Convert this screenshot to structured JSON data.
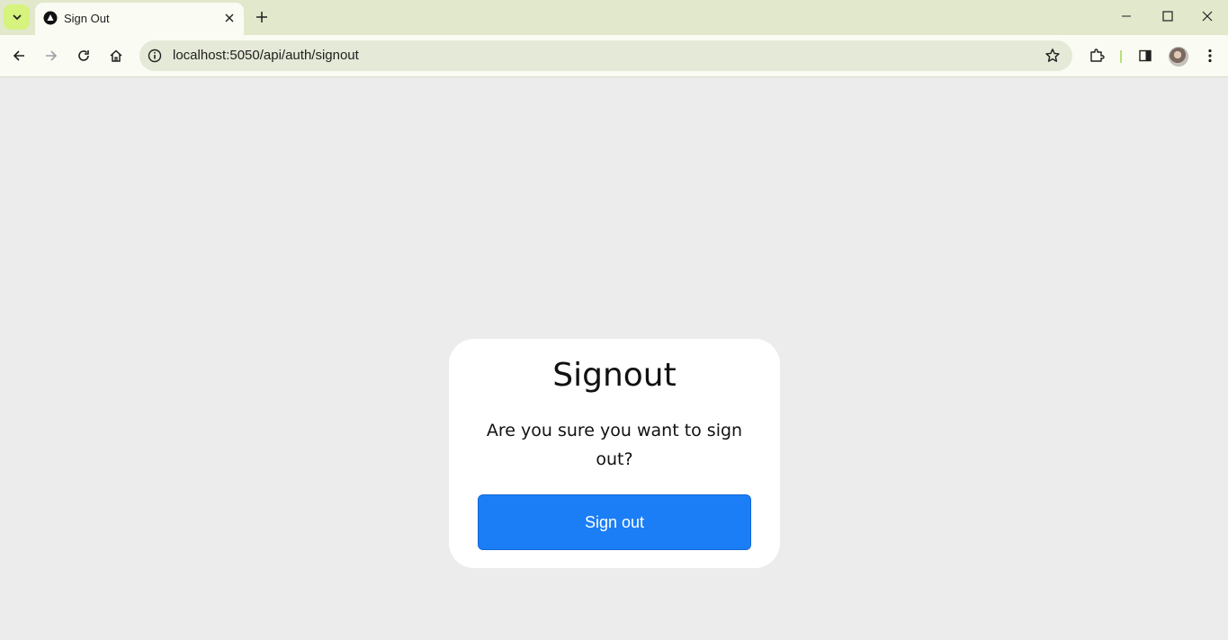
{
  "browser": {
    "tab": {
      "title": "Sign Out"
    },
    "address_bar": {
      "url": "localhost:5050/api/auth/signout"
    },
    "colors": {
      "tabstrip": "#e1e8cc",
      "toolbar": "#fafbf2",
      "accent": "#d6f37e"
    }
  },
  "page": {
    "title": "Signout",
    "message": "Are you sure you want to sign out?",
    "signout_button_label": "Sign out",
    "colors": {
      "background": "#ececec",
      "card": "#ffffff",
      "button": "#1b7ef6"
    }
  },
  "icons": [
    "tab-search-icon",
    "favicon-icon",
    "close-icon",
    "plus-icon",
    "minimize-icon",
    "maximize-icon",
    "window-close-icon",
    "back-icon",
    "forward-icon",
    "reload-icon",
    "home-icon",
    "site-info-icon",
    "star-icon",
    "extensions-icon",
    "side-panel-icon",
    "avatar",
    "more-icon"
  ]
}
